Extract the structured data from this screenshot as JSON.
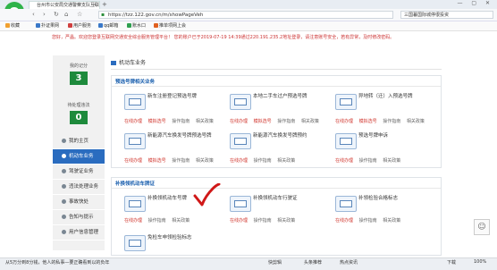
{
  "browser": {
    "tab_title": "台州市公安局交通警察支队互联网",
    "url": "https://tzz.122.gov.cn/m/showPageVeh",
    "search_text": "三国暮国际城停很投资",
    "bookmarks": [
      "收藏",
      "扑证果网",
      "用户服务",
      "qq邮箱",
      "账水口",
      "推单项网上会"
    ]
  },
  "notice": "您好，严晶。欢迎您登录互联网交通安全综合服务管理平台！ 您的账户已于2019-07-19 14:39通过220.191.235.2地址登录，请注意账号安全，若有异常，及时修改密码。",
  "sidebar": {
    "stats": [
      {
        "label": "我的记分",
        "value": "3"
      },
      {
        "label": "待处理违法",
        "value": "0"
      }
    ],
    "nav": [
      {
        "label": "我的主页",
        "active": false
      },
      {
        "label": "机动车业务",
        "active": true
      },
      {
        "label": "驾驶证业务",
        "active": false
      },
      {
        "label": "违法处理业务",
        "active": false
      },
      {
        "label": "事故快处",
        "active": false
      },
      {
        "label": "告知与提示",
        "active": false
      },
      {
        "label": "用户信息管理",
        "active": false
      }
    ]
  },
  "main": {
    "breadcrumb": "机动车业务",
    "sections": [
      {
        "title": "预选号牌相关业务",
        "items": [
          {
            "name": "新车注册登记预选号牌",
            "actions": [
              "在线办理",
              "模拟选号",
              "操作指南",
              "相关政策"
            ]
          },
          {
            "name": "本地二手车过户预选号牌",
            "actions": [
              "在线办理",
              "模拟选号",
              "操作指南",
              "相关政策"
            ]
          },
          {
            "name": "异地转（迁）入预选号牌",
            "actions": [
              "在线办理",
              "模拟选号",
              "操作指南",
              "相关政策"
            ]
          },
          {
            "name": "新能源汽车换发号牌预选号牌",
            "actions": [
              "在线办理",
              "模拟选号",
              "操作指南",
              "相关政策"
            ]
          },
          {
            "name": "新能源汽车换发号牌预约",
            "actions": [
              "在线办理",
              "操作指南",
              "相关政策"
            ]
          },
          {
            "name": "预选号牌申诉",
            "actions": [
              "在线办理",
              "操作指南",
              "相关政策"
            ]
          }
        ]
      },
      {
        "title": "补换领机动车牌证",
        "items": [
          {
            "name": "补换领机动车号牌",
            "actions": [
              "在线办理",
              "操作指南",
              "相关政策"
            ]
          },
          {
            "name": "补换领机动车行驶证",
            "actions": [
              "在线办理",
              "操作指南",
              "相关政策"
            ]
          },
          {
            "name": "补领检验合格标志",
            "actions": [
              "在线办理",
              "操作指南",
              "相关政策"
            ]
          },
          {
            "name": "免检车申领检验标志",
            "actions": []
          }
        ]
      }
    ]
  },
  "statusbar": {
    "left_text": "从5万分到8分钱，他人的私事—要正确看到以的负年",
    "right_items": [
      "快剪辑",
      "头条推荐",
      "热点资讯",
      "下载",
      "100%"
    ]
  }
}
